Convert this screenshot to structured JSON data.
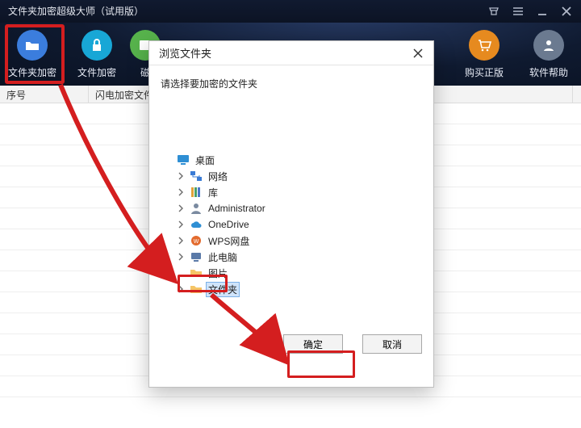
{
  "app": {
    "title": "文件夹加密超级大师（试用版）"
  },
  "title_icons": {
    "shirt": "shirt-icon",
    "menu": "menu-icon",
    "min": "minimize-icon",
    "close": "close-icon"
  },
  "toolbar": {
    "items": [
      {
        "label": "文件夹加密",
        "color": "c-blue",
        "icon": "folder-icon"
      },
      {
        "label": "文件加密",
        "color": "c-cyan",
        "icon": "lock-icon"
      },
      {
        "label": "磁",
        "color": "c-green",
        "icon": "disk-icon"
      },
      {
        "label": "购买正版",
        "color": "c-orange",
        "icon": "cart-icon"
      },
      {
        "label": "软件帮助",
        "color": "c-slate",
        "icon": "user-icon"
      }
    ]
  },
  "list": {
    "col_a": "序号",
    "col_b": "闪电加密文件夹"
  },
  "dialog": {
    "title": "浏览文件夹",
    "instruction": "请选择要加密的文件夹",
    "ok": "确定",
    "cancel": "取消",
    "tree": [
      {
        "depth": 0,
        "label": "桌面",
        "icon": "monitor-icon",
        "expander": "none"
      },
      {
        "depth": 1,
        "label": "网络",
        "icon": "network-icon",
        "expander": "closed"
      },
      {
        "depth": 1,
        "label": "库",
        "icon": "library-icon",
        "expander": "closed"
      },
      {
        "depth": 1,
        "label": "Administrator",
        "icon": "user-icon",
        "expander": "closed"
      },
      {
        "depth": 1,
        "label": "OneDrive",
        "icon": "cloud-icon",
        "expander": "closed"
      },
      {
        "depth": 1,
        "label": "WPS网盘",
        "icon": "wps-icon",
        "expander": "closed"
      },
      {
        "depth": 1,
        "label": "此电脑",
        "icon": "computer-icon",
        "expander": "closed"
      },
      {
        "depth": 1,
        "label": "图片",
        "icon": "folder-icon",
        "expander": "none"
      },
      {
        "depth": 1,
        "label": "文件夹",
        "icon": "folder-icon",
        "expander": "closed",
        "selected": true
      }
    ]
  },
  "highlights": {
    "first_toolbar_item": true,
    "selected_tree_node": true,
    "ok_button": true
  },
  "colors": {
    "accent_red": "#d41e1f",
    "selection_bg": "#cfe4fb"
  }
}
